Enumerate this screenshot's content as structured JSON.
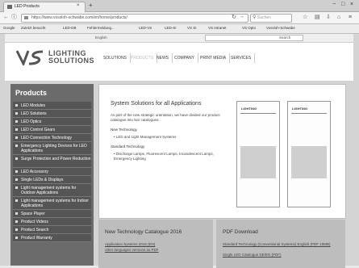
{
  "browser": {
    "tab_title": "LED Products",
    "new_tab": "+",
    "url": "https://www.vossloh-schwabe.com/en/home/products/",
    "search_placeholder": "Suchen",
    "window_controls": [
      "−",
      "□",
      "×"
    ],
    "bookmarks": [
      "Google",
      "Zuletzt besucht",
      "LED-DB",
      "Fehlermeldung...",
      "LED-VS",
      "LED-SI",
      "VS SI",
      "VS Intranet",
      "VS Opto",
      "Vossloh-Schwabe"
    ]
  },
  "header": {
    "strip_left": "English",
    "strip_search": "Search",
    "strip_right": "Search",
    "logo_line1": "LIGHTING",
    "logo_line2": "SOLUTIONS",
    "nav": [
      "SOLUTIONS",
      "PRODUCTS",
      "NEWS",
      "COMPANY",
      "PRINT MEDIA",
      "SERVICES"
    ]
  },
  "sidebar": {
    "title": "Products",
    "items": [
      "LED Modules",
      "LED Solutions",
      "LED Optics",
      "LED Control Gears",
      "LED Connection Technology",
      "Emergency Lighting Devices for LED Applications",
      "Surge Protection and Power Reduction",
      "LED Accessory",
      "Single LEDs & Displays",
      "Light management systems for Outdoor Applications",
      "Light management systems for Indoor Applications",
      "Space Player",
      "Product Videos",
      "Product Search",
      "Product Warranty"
    ]
  },
  "content": {
    "heading": "System Solutions for all Applications",
    "intro": "As part of the new strategic orientation, we have divided our product catalogue into two catalogues:",
    "new_tech_title": "New Technology",
    "new_tech_items": [
      "LED and Light Management Systems"
    ],
    "std_tech_title": "Standard Technology",
    "std_tech_items": [
      "Discharge Lamps, Fluorescent Lamps, Incandescent Lamps, Emergency Lighting"
    ],
    "catalogue1_label": "LIGHTING",
    "catalogue2_label": "LIGHTING"
  },
  "box_new": {
    "title": "New Technology Catalogue 2016",
    "links": [
      "Application Systems 2016 (EN)",
      "other languages versions as PDF"
    ]
  },
  "box_pdf": {
    "title": "PDF Download",
    "links": [
      "Standard Technology (Conventional Systems) English (PDF 10MB)",
      "Single LED Catalogue DE/EN (PDF)"
    ]
  }
}
